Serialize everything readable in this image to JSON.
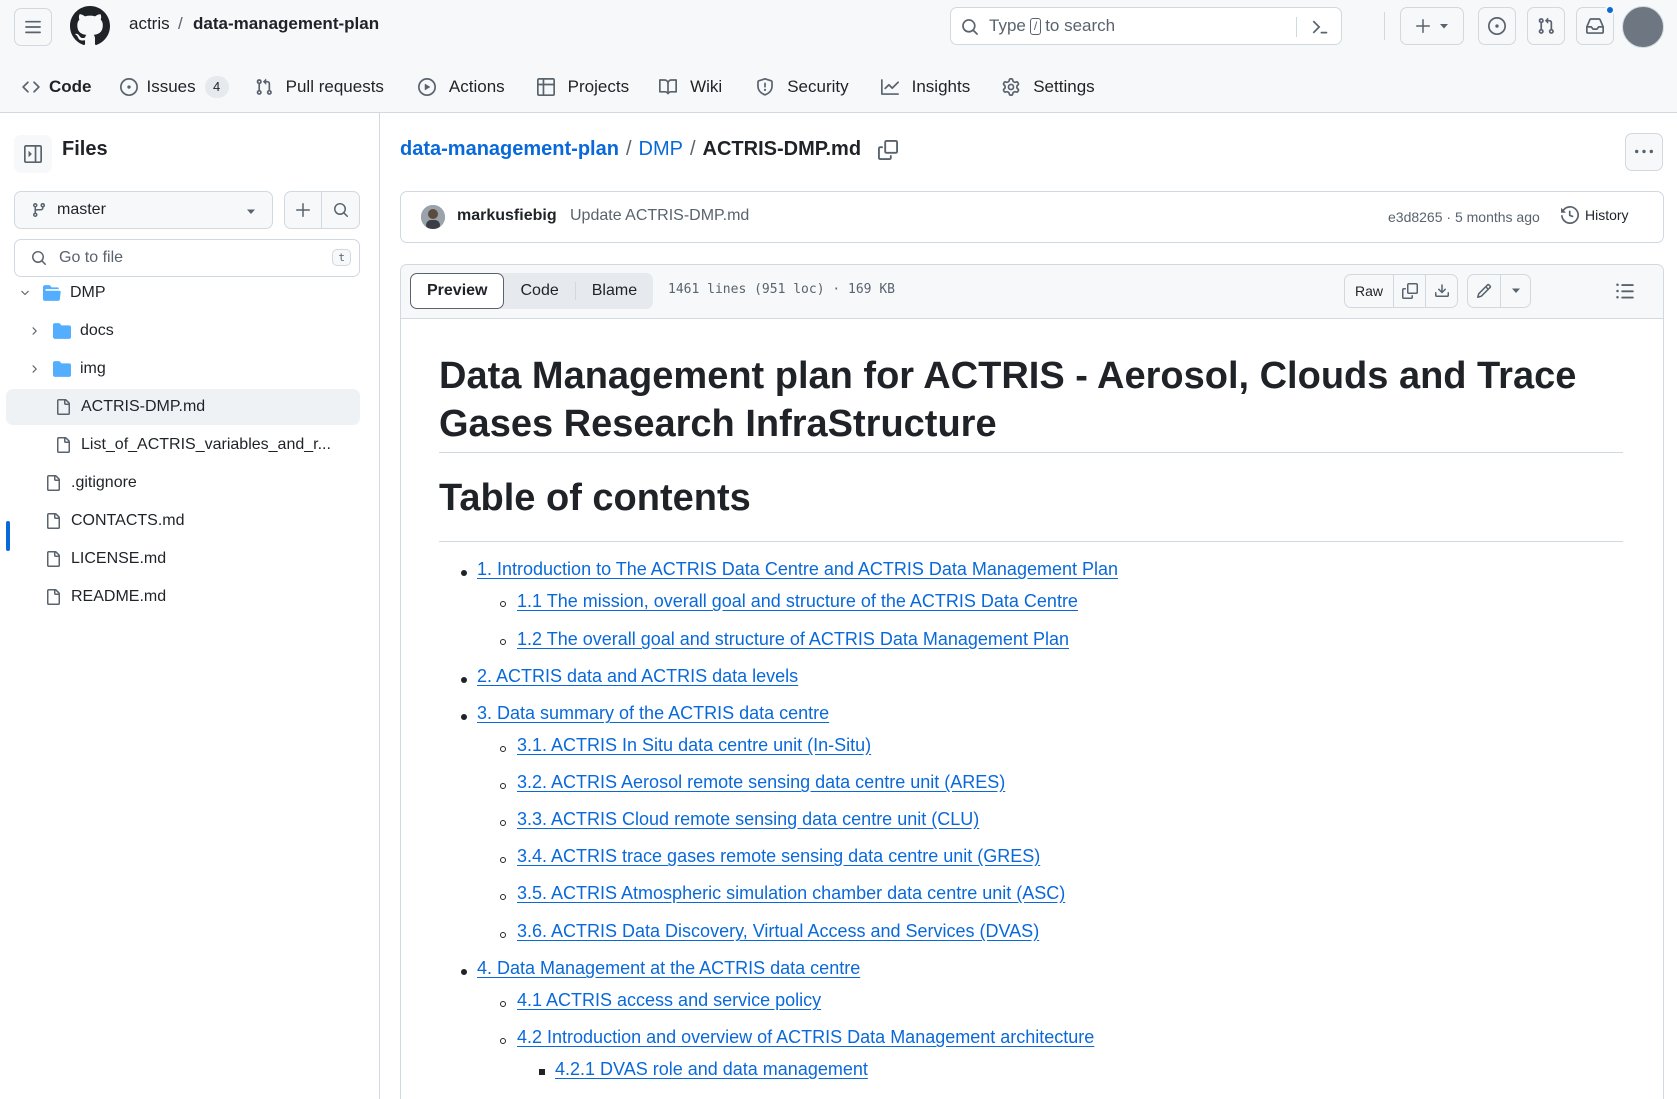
{
  "header": {
    "owner": "actris",
    "separator": "/",
    "repo": "data-management-plan",
    "search_prefix": "Type",
    "search_key": "/",
    "search_suffix": "to search"
  },
  "nav": {
    "code": "Code",
    "issues": "Issues",
    "issues_count": "4",
    "pull_requests": "Pull requests",
    "actions": "Actions",
    "projects": "Projects",
    "wiki": "Wiki",
    "security": "Security",
    "insights": "Insights",
    "settings": "Settings"
  },
  "sidebar": {
    "title": "Files",
    "branch": "master",
    "goto_placeholder": "Go to file",
    "goto_key": "t",
    "tree": [
      {
        "label": "DMP",
        "type": "folder",
        "expanded": true
      },
      {
        "label": "docs",
        "type": "folder",
        "expanded": false
      },
      {
        "label": "img",
        "type": "folder",
        "expanded": false
      },
      {
        "label": "ACTRIS-DMP.md",
        "type": "file",
        "selected": true
      },
      {
        "label": "List_of_ACTRIS_variables_and_r...",
        "type": "file"
      },
      {
        "label": ".gitignore",
        "type": "file"
      },
      {
        "label": "CONTACTS.md",
        "type": "file"
      },
      {
        "label": "LICENSE.md",
        "type": "file"
      },
      {
        "label": "README.md",
        "type": "file"
      }
    ]
  },
  "breadcrumb": {
    "repo": "data-management-plan",
    "folder": "DMP",
    "file": "ACTRIS-DMP.md",
    "sep": "/"
  },
  "commit": {
    "author": "markusfiebig",
    "message": "Update ACTRIS-DMP.md",
    "meta": "e3d8265 · 5 months ago",
    "history": "History"
  },
  "file_header": {
    "tab_preview": "Preview",
    "tab_code": "Code",
    "tab_blame": "Blame",
    "info": "1461 lines (951 loc) · 169 KB",
    "raw": "Raw"
  },
  "content": {
    "title": "Data Management plan for ACTRIS - Aerosol, Clouds and Trace Gases Research InfraStructure",
    "toc_heading": "Table of contents",
    "toc": [
      {
        "level": 1,
        "text": "1. Introduction to The ACTRIS Data Centre and ACTRIS Data Management Plan"
      },
      {
        "level": 2,
        "text": "1.1 The mission, overall goal and structure of the ACTRIS Data Centre"
      },
      {
        "level": 2,
        "text": "1.2 The overall goal and structure of ACTRIS Data Management Plan"
      },
      {
        "level": 1,
        "text": "2. ACTRIS data and ACTRIS data levels"
      },
      {
        "level": 1,
        "text": "3. Data summary of the ACTRIS data centre"
      },
      {
        "level": 2,
        "text": "3.1. ACTRIS In Situ data centre unit (In-Situ)"
      },
      {
        "level": 2,
        "text": "3.2. ACTRIS Aerosol remote sensing data centre unit (ARES)"
      },
      {
        "level": 2,
        "text": "3.3. ACTRIS Cloud remote sensing data centre unit (CLU)"
      },
      {
        "level": 2,
        "text": "3.4. ACTRIS trace gases remote sensing data centre unit (GRES)"
      },
      {
        "level": 2,
        "text": "3.5. ACTRIS Atmospheric simulation chamber data centre unit (ASC)"
      },
      {
        "level": 2,
        "text": "3.6. ACTRIS Data Discovery, Virtual Access and Services (DVAS)"
      },
      {
        "level": 1,
        "text": "4. Data Management at the ACTRIS data centre"
      },
      {
        "level": 2,
        "text": "4.1 ACTRIS access and service policy"
      },
      {
        "level": 2,
        "text": "4.2 Introduction and overview of ACTRIS Data Management architecture"
      },
      {
        "level": 3,
        "text": "4.2.1 DVAS role and data management"
      }
    ]
  }
}
